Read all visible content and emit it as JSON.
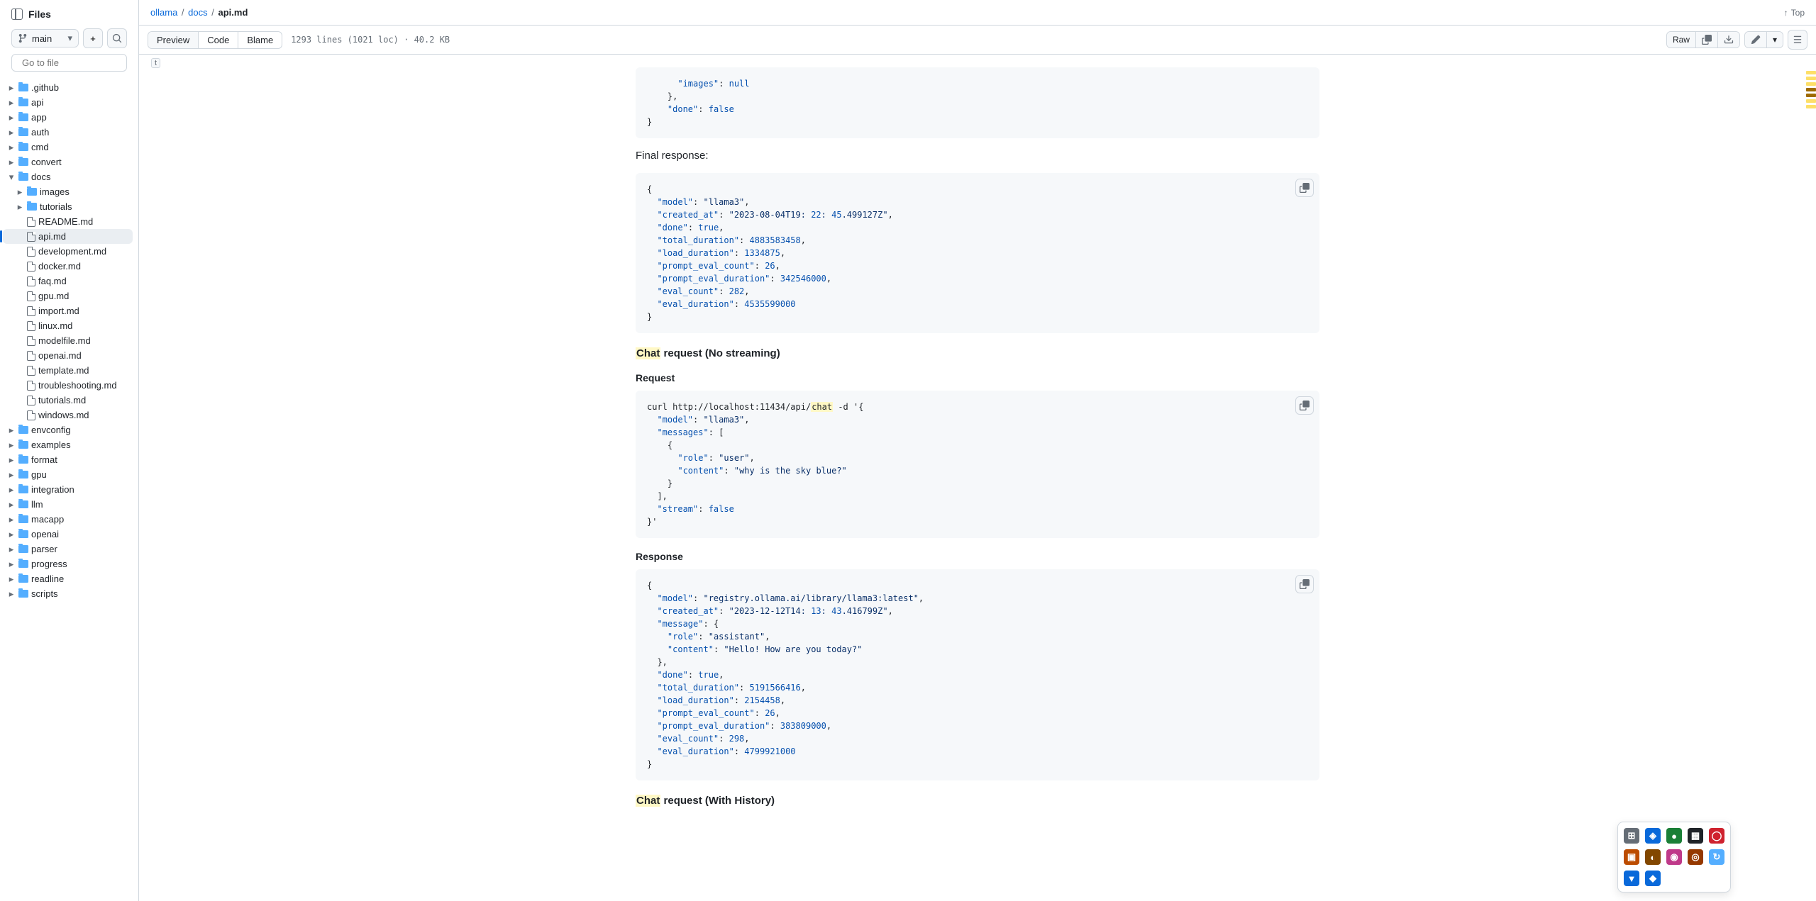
{
  "sidebar": {
    "title": "Files",
    "branch": "main",
    "search_placeholder": "Go to file",
    "search_kbd": "t",
    "tree": [
      {
        "type": "folder",
        "name": ".github",
        "indent": 0,
        "open": false
      },
      {
        "type": "folder",
        "name": "api",
        "indent": 0,
        "open": false
      },
      {
        "type": "folder",
        "name": "app",
        "indent": 0,
        "open": false
      },
      {
        "type": "folder",
        "name": "auth",
        "indent": 0,
        "open": false
      },
      {
        "type": "folder",
        "name": "cmd",
        "indent": 0,
        "open": false
      },
      {
        "type": "folder",
        "name": "convert",
        "indent": 0,
        "open": false
      },
      {
        "type": "folder",
        "name": "docs",
        "indent": 0,
        "open": true
      },
      {
        "type": "folder",
        "name": "images",
        "indent": 1,
        "open": false
      },
      {
        "type": "folder",
        "name": "tutorials",
        "indent": 1,
        "open": false
      },
      {
        "type": "file",
        "name": "README.md",
        "indent": 1
      },
      {
        "type": "file",
        "name": "api.md",
        "indent": 1,
        "active": true
      },
      {
        "type": "file",
        "name": "development.md",
        "indent": 1
      },
      {
        "type": "file",
        "name": "docker.md",
        "indent": 1
      },
      {
        "type": "file",
        "name": "faq.md",
        "indent": 1
      },
      {
        "type": "file",
        "name": "gpu.md",
        "indent": 1
      },
      {
        "type": "file",
        "name": "import.md",
        "indent": 1
      },
      {
        "type": "file",
        "name": "linux.md",
        "indent": 1
      },
      {
        "type": "file",
        "name": "modelfile.md",
        "indent": 1
      },
      {
        "type": "file",
        "name": "openai.md",
        "indent": 1
      },
      {
        "type": "file",
        "name": "template.md",
        "indent": 1
      },
      {
        "type": "file",
        "name": "troubleshooting.md",
        "indent": 1
      },
      {
        "type": "file",
        "name": "tutorials.md",
        "indent": 1
      },
      {
        "type": "file",
        "name": "windows.md",
        "indent": 1
      },
      {
        "type": "folder",
        "name": "envconfig",
        "indent": 0,
        "open": false
      },
      {
        "type": "folder",
        "name": "examples",
        "indent": 0,
        "open": false
      },
      {
        "type": "folder",
        "name": "format",
        "indent": 0,
        "open": false
      },
      {
        "type": "folder",
        "name": "gpu",
        "indent": 0,
        "open": false
      },
      {
        "type": "folder",
        "name": "integration",
        "indent": 0,
        "open": false
      },
      {
        "type": "folder",
        "name": "llm",
        "indent": 0,
        "open": false
      },
      {
        "type": "folder",
        "name": "macapp",
        "indent": 0,
        "open": false
      },
      {
        "type": "folder",
        "name": "openai",
        "indent": 0,
        "open": false
      },
      {
        "type": "folder",
        "name": "parser",
        "indent": 0,
        "open": false
      },
      {
        "type": "folder",
        "name": "progress",
        "indent": 0,
        "open": false
      },
      {
        "type": "folder",
        "name": "readline",
        "indent": 0,
        "open": false
      },
      {
        "type": "folder",
        "name": "scripts",
        "indent": 0,
        "open": false
      }
    ]
  },
  "breadcrumb": {
    "parts": [
      "ollama",
      "docs"
    ],
    "current": "api.md",
    "top_label": "Top"
  },
  "toolbar": {
    "tabs": [
      "Preview",
      "Code",
      "Blame"
    ],
    "active_tab": "Preview",
    "meta": "1293 lines (1021 loc) · 40.2 KB",
    "raw_label": "Raw"
  },
  "content": {
    "code0": "      \"images\": null\n    },\n    \"done\": false\n}",
    "final_response_label": "Final response:",
    "code1": "{\n  \"model\": \"llama3\",\n  \"created_at\": \"2023-08-04T19:22:45.499127Z\",\n  \"done\": true,\n  \"total_duration\": 4883583458,\n  \"load_duration\": 1334875,\n  \"prompt_eval_count\": 26,\n  \"prompt_eval_duration\": 342546000,\n  \"eval_count\": 282,\n  \"eval_duration\": 4535599000\n}",
    "heading_chat_no_stream_hl": "Chat",
    "heading_chat_no_stream_rest": " request (No streaming)",
    "request_label": "Request",
    "code2_pre": "curl http://localhost:11434/api/",
    "code2_hl": "chat",
    "code2_post": " -d '{\n  \"model\": \"llama3\",\n  \"messages\": [\n    {\n      \"role\": \"user\",\n      \"content\": \"why is the sky blue?\"\n    }\n  ],\n  \"stream\": false\n}'",
    "response_label": "Response",
    "code3": "{\n  \"model\": \"registry.ollama.ai/library/llama3:latest\",\n  \"created_at\": \"2023-12-12T14:13:43.416799Z\",\n  \"message\": {\n    \"role\": \"assistant\",\n    \"content\": \"Hello! How are you today?\"\n  },\n  \"done\": true,\n  \"total_duration\": 5191566416,\n  \"load_duration\": 2154458,\n  \"prompt_eval_count\": 26,\n  \"prompt_eval_duration\": 383809000,\n  \"eval_count\": 298,\n  \"eval_duration\": 4799921000\n}",
    "heading_chat_history_hl": "Chat",
    "heading_chat_history_rest": " request (With History)"
  },
  "ext_colors": [
    "#656d76",
    "#0969da",
    "#1a7f37",
    "#1f2328",
    "#cf222e",
    "#bc4c00",
    "#824700",
    "#bf3989",
    "#953800",
    "#54aeff",
    "#0969da",
    "#0969da"
  ]
}
